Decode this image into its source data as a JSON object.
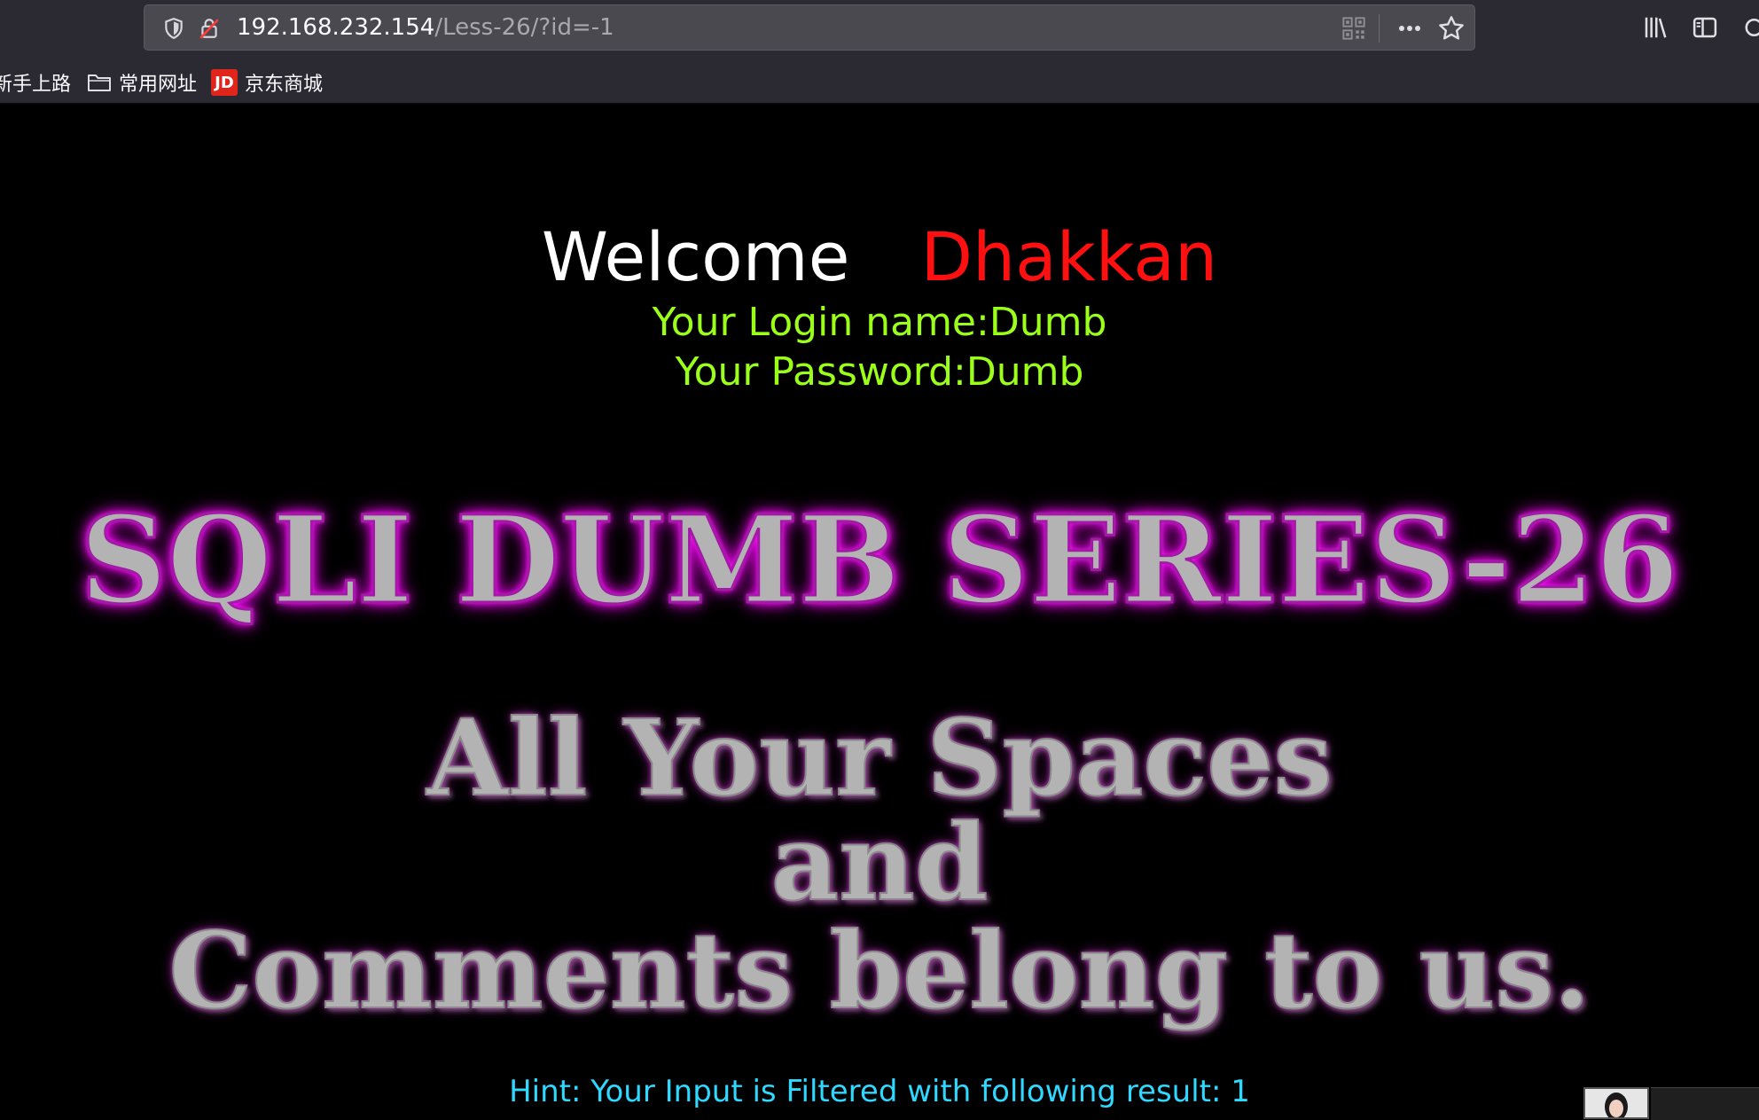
{
  "browser": {
    "url_host": "192.168.232.154",
    "url_path": "/Less-26/?id=-1",
    "bookmarks": [
      {
        "label": "新手上路"
      },
      {
        "label": "常用网址"
      },
      {
        "label": "京东商城",
        "badge": "JD"
      }
    ]
  },
  "page": {
    "welcome_word": "Welcome",
    "welcome_name": "Dhakkan",
    "login_name_line": "Your Login name:Dumb",
    "password_line": "Your Password:Dumb",
    "banner_title": "SQLI DUMB SERIES-26",
    "slogan_line1": "All Your Spaces",
    "slogan_line2": "and",
    "slogan_line3": "Comments belong to us.",
    "hint": "Hint: Your Input is Filtered with following result: 1"
  },
  "colors": {
    "background": "#000000",
    "welcome_name": "#ff1010",
    "credentials": "#9bff1a",
    "banner_glow": "#ff00ff",
    "hint": "#2fd8ff"
  }
}
